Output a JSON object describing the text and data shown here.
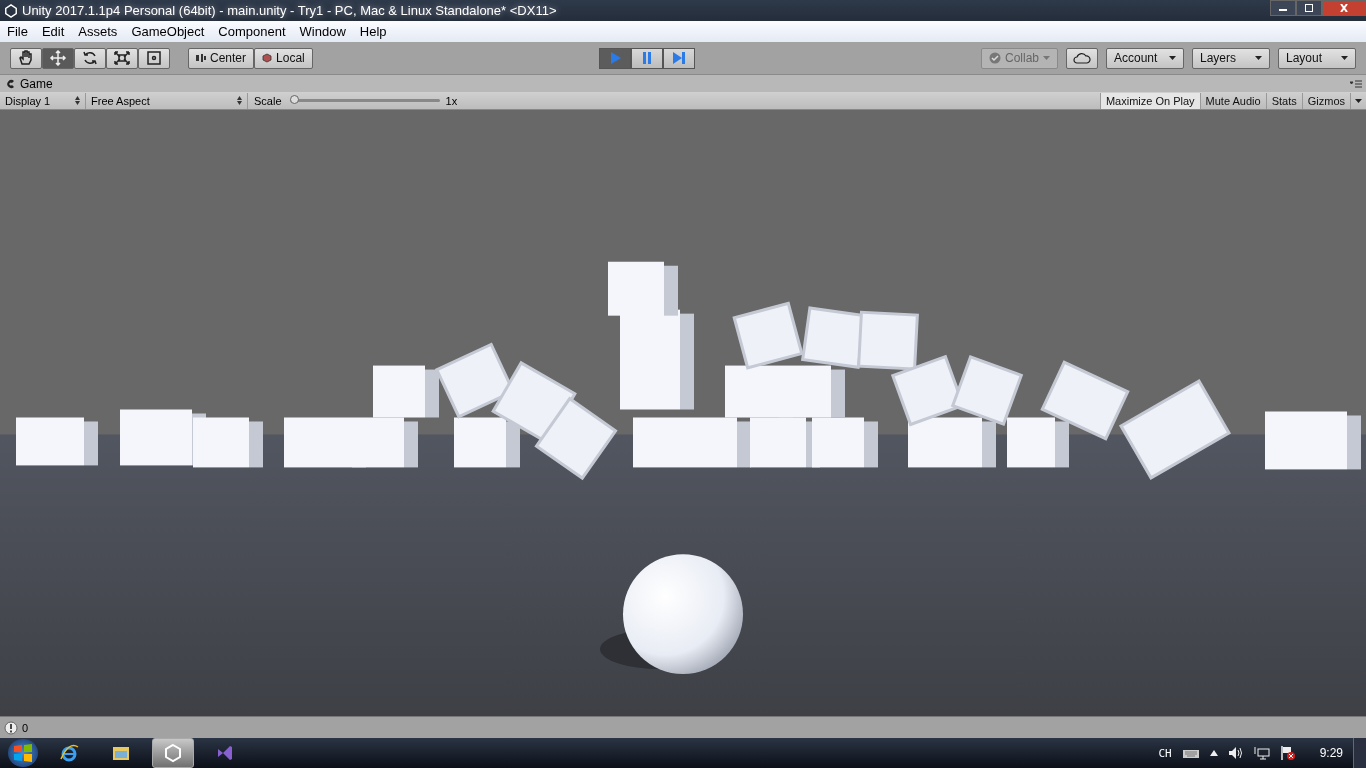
{
  "window": {
    "title": "Unity 2017.1.1p4 Personal (64bit) - main.unity - Try1 - PC, Mac & Linux Standalone* <DX11>"
  },
  "menu": [
    "File",
    "Edit",
    "Assets",
    "GameObject",
    "Component",
    "Window",
    "Help"
  ],
  "toolbar": {
    "tools": [
      {
        "kind": "hand",
        "selected": false
      },
      {
        "kind": "move",
        "selected": true
      },
      {
        "kind": "rotate",
        "selected": false
      },
      {
        "kind": "scale",
        "selected": false
      },
      {
        "kind": "rect",
        "selected": false
      }
    ],
    "pivot": [
      {
        "kind": "center",
        "label": "Center"
      },
      {
        "kind": "local",
        "label": "Local"
      }
    ],
    "playback": [
      {
        "kind": "play",
        "on": true
      },
      {
        "kind": "pause",
        "on": false
      },
      {
        "kind": "step",
        "on": false
      }
    ],
    "collab": {
      "label": "Collab",
      "disabled": true
    },
    "dropdowns": [
      "Account",
      "Layers",
      "Layout"
    ]
  },
  "game_tab": {
    "title": "Game"
  },
  "game_toolbar": {
    "display": "Display 1",
    "aspect": "Free Aspect",
    "scale_label": "Scale",
    "scale": {
      "level": 0.0
    },
    "scale_reading": "1x",
    "toggles": [
      {
        "label": "Maximize On Play",
        "selected": true
      },
      {
        "label": "Mute Audio",
        "selected": false
      },
      {
        "label": "Stats",
        "selected": false
      },
      {
        "label": "Gizmos",
        "selected": false
      }
    ]
  },
  "status_bar": {
    "count": "0"
  },
  "taskbar": {
    "apps": [
      {
        "kind": "ie",
        "selected": false
      },
      {
        "kind": "folder",
        "selected": false
      },
      {
        "kind": "unity",
        "selected": true
      },
      {
        "kind": "vs",
        "selected": false
      }
    ],
    "language": "CH",
    "clock": "9:29"
  }
}
